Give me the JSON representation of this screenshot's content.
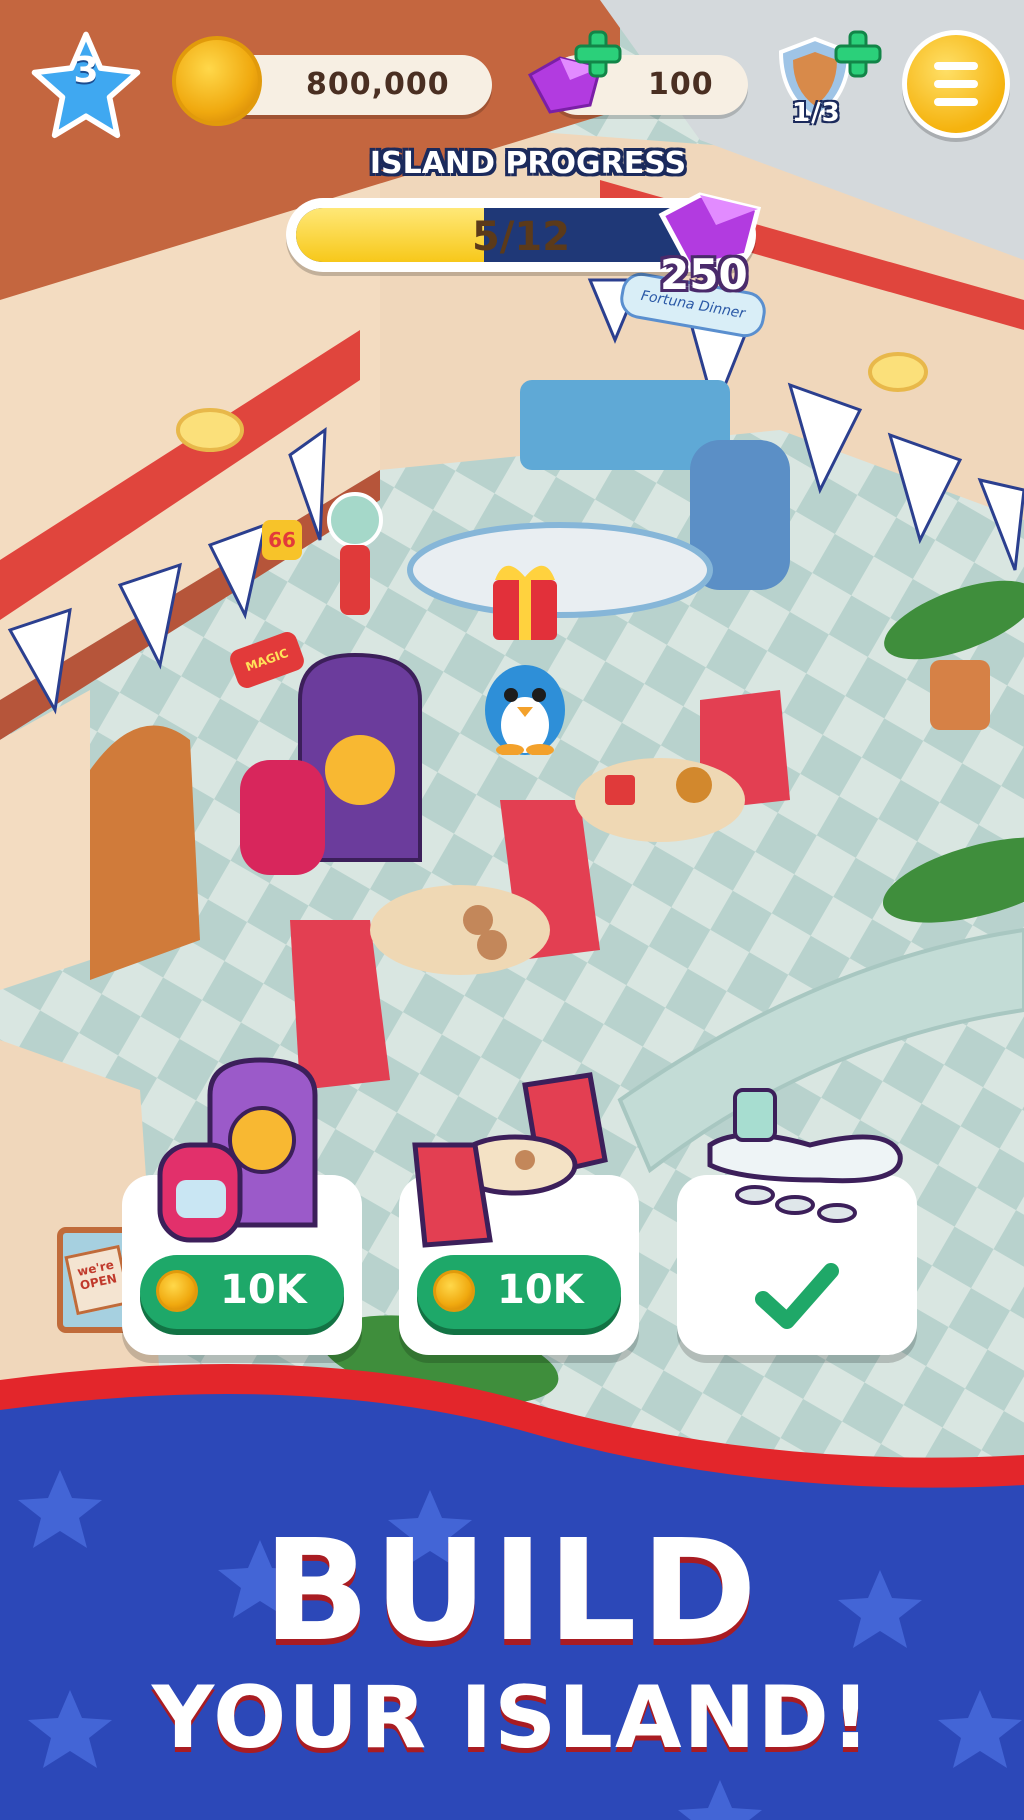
{
  "hud": {
    "level": "3",
    "coins": "800,000",
    "gems": "100",
    "shields": "1/3"
  },
  "progress": {
    "title": "ISLAND PROGRESS",
    "current": 5,
    "total": 12,
    "label": "5/12",
    "reward": "250"
  },
  "build_items": [
    {
      "name": "jukebox-set",
      "price": "10K",
      "completed": false
    },
    {
      "name": "diner-booth-set",
      "price": "10K",
      "completed": false
    },
    {
      "name": "diner-counter",
      "price": "",
      "completed": true
    }
  ],
  "banner": {
    "line1": "BUILD",
    "line2": "YOUR ISLAND!"
  },
  "scene_text": {
    "sign_magic": "MAGIC",
    "sign_66": "66",
    "sign_diner": "Fortuna Dinner",
    "sign_open": "we're OPEN"
  },
  "colors": {
    "banner_blue": "#2c48b8",
    "banner_red": "#e3262b",
    "button_green": "#1ea869",
    "progress_fill": "#f7c81a",
    "progress_track": "#1f3877",
    "gem_purple": "#b23be0"
  }
}
